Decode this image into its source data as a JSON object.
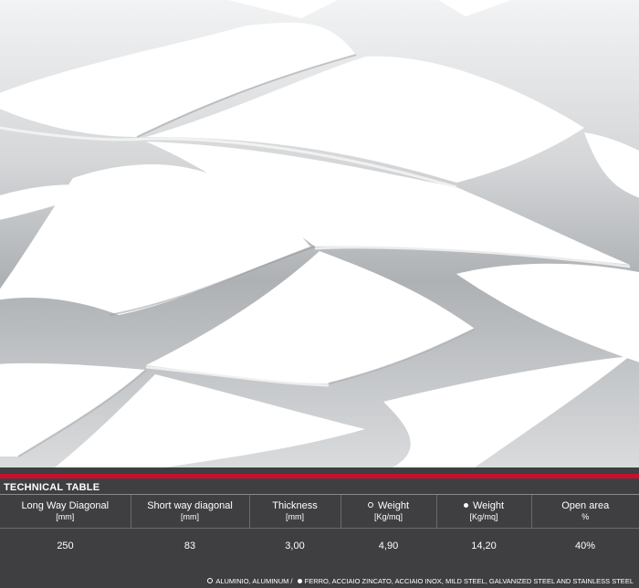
{
  "colors": {
    "panel_bg": "#3f3f41",
    "accent": "#c8102e",
    "text": "#ffffff"
  },
  "technical_table": {
    "title": "TECHNICAL TABLE",
    "columns": [
      {
        "label": "Long Way Diagonal",
        "unit": "[mm]",
        "icon": ""
      },
      {
        "label": "Short way diagonal",
        "unit": "[mm]",
        "icon": ""
      },
      {
        "label": "Thickness",
        "unit": "[mm]",
        "icon": ""
      },
      {
        "label": "Weight",
        "unit": "[Kg/mq]",
        "icon": "hollow-circle-icon"
      },
      {
        "label": "Weight",
        "unit": "[Kg/mq]",
        "icon": "filled-circle-icon"
      },
      {
        "label": "Open area",
        "unit": "%",
        "icon": ""
      }
    ],
    "rows": [
      [
        "250",
        "83",
        "3,00",
        "4,90",
        "14,20",
        "40%"
      ]
    ]
  },
  "legend": {
    "aluminium": "ALUMINIO, ALUMINUM /",
    "steel": "FERRO, ACCIAIO ZINCATO, ACCIAIO INOX, MILD STEEL, GALVANIZED STEEL AND STAINLESS STEEL"
  }
}
